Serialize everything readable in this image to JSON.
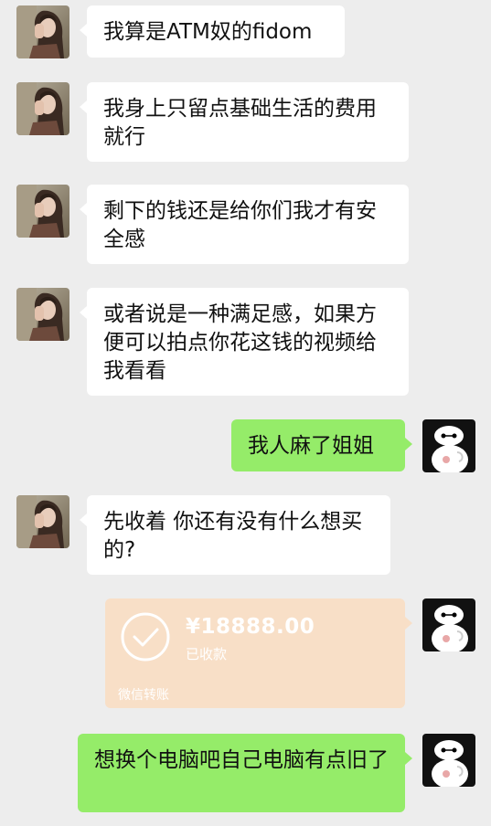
{
  "chat": {
    "messages": [
      {
        "side": "left",
        "text": "我算是ATM奴的fidom"
      },
      {
        "side": "left",
        "text": "我身上只留点基础生活的费用就行"
      },
      {
        "side": "left",
        "text": "剩下的钱还是给你们我才有安全感"
      },
      {
        "side": "left",
        "text": "或者说是一种满足感，如果方便可以拍点你花这钱的视频给我看看"
      },
      {
        "side": "right",
        "text": "我人麻了姐姐"
      },
      {
        "side": "left",
        "text": "先收着 你还有没有什么想买的?"
      },
      {
        "side": "right",
        "text": "想换个电脑吧自己电脑有点旧了"
      }
    ],
    "transfer": {
      "amount": "¥18888.00",
      "status": "已收款",
      "footer": "微信转账"
    }
  },
  "colors": {
    "background": "#ededed",
    "bubble_left": "#ffffff",
    "bubble_right": "#95ec69",
    "transfer_received": "#f8dfc7"
  },
  "icons": {
    "left_avatar": "girl-photo-avatar",
    "right_avatar": "baymax-avatar",
    "transfer_status": "check-circle-icon"
  }
}
